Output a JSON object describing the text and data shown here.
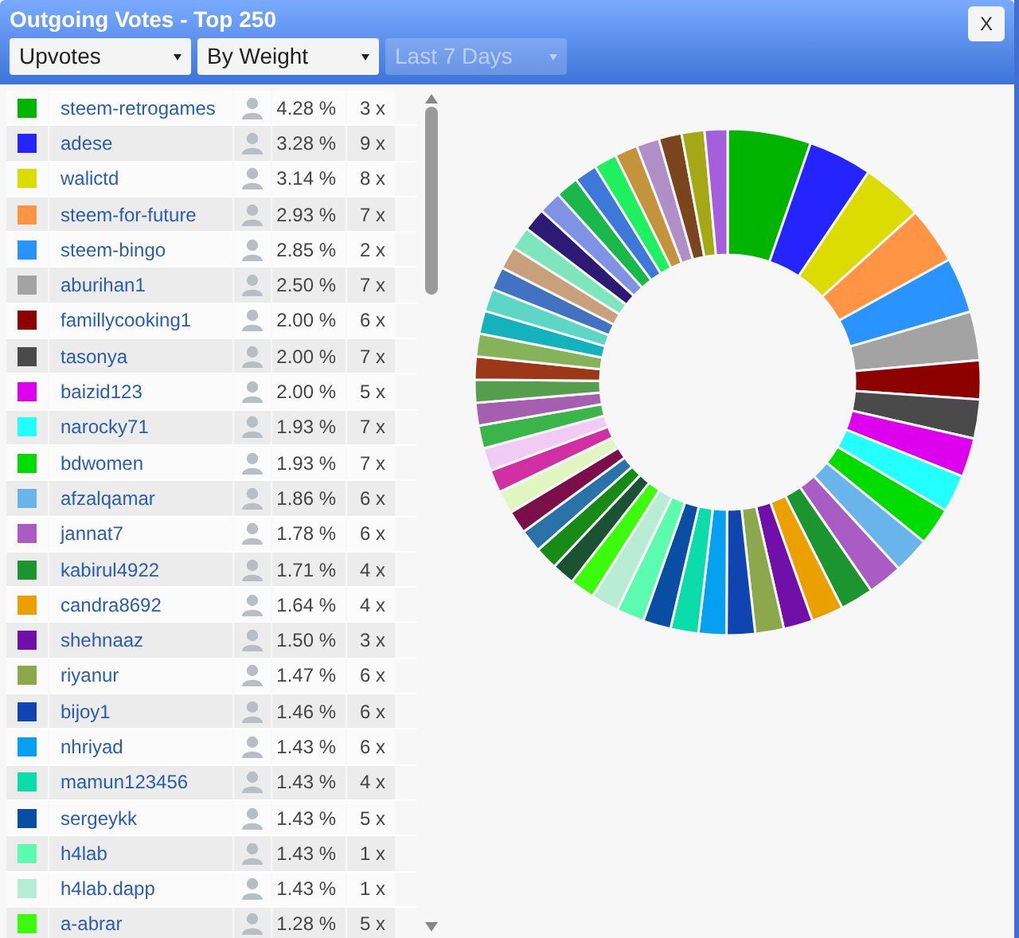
{
  "window": {
    "title": "Outgoing Votes - Top 250",
    "close": "X"
  },
  "filters": [
    {
      "value": "Upvotes",
      "disabled": false
    },
    {
      "value": "By Weight",
      "disabled": false
    },
    {
      "value": "Last 7 Days",
      "disabled": true
    }
  ],
  "rows": [
    {
      "color": "#00b400",
      "name": "steem-retrogames",
      "percent": "4.28 %",
      "count": "3 x"
    },
    {
      "color": "#2424ff",
      "name": "adese",
      "percent": "3.28 %",
      "count": "9 x"
    },
    {
      "color": "#dcdc00",
      "name": "walictd",
      "percent": "3.14 %",
      "count": "8 x"
    },
    {
      "color": "#ff9444",
      "name": "steem-for-future",
      "percent": "2.93 %",
      "count": "7 x"
    },
    {
      "color": "#2994ff",
      "name": "steem-bingo",
      "percent": "2.85 %",
      "count": "2 x"
    },
    {
      "color": "#a3a3a3",
      "name": "aburihan1",
      "percent": "2.50 %",
      "count": "7 x"
    },
    {
      "color": "#8c0000",
      "name": "famillycooking1",
      "percent": "2.00 %",
      "count": "6 x"
    },
    {
      "color": "#4a4a4a",
      "name": "tasonya",
      "percent": "2.00 %",
      "count": "7 x"
    },
    {
      "color": "#dc00ec",
      "name": "baizid123",
      "percent": "2.00 %",
      "count": "5 x"
    },
    {
      "color": "#24ffff",
      "name": "narocky71",
      "percent": "1.93 %",
      "count": "7 x"
    },
    {
      "color": "#00dc00",
      "name": "bdwomen",
      "percent": "1.93 %",
      "count": "7 x"
    },
    {
      "color": "#6ab4ec",
      "name": "afzalqamar",
      "percent": "1.86 %",
      "count": "6 x"
    },
    {
      "color": "#a95cc4",
      "name": "jannat7",
      "percent": "1.78 %",
      "count": "6 x"
    },
    {
      "color": "#1c9430",
      "name": "kabirul4922",
      "percent": "1.71 %",
      "count": "4 x"
    },
    {
      "color": "#eca000",
      "name": "candra8692",
      "percent": "1.64 %",
      "count": "4 x"
    },
    {
      "color": "#7010a8",
      "name": "shehnaaz",
      "percent": "1.50 %",
      "count": "3 x"
    },
    {
      "color": "#8ca84c",
      "name": "riyanur",
      "percent": "1.47 %",
      "count": "6 x"
    },
    {
      "color": "#1044b0",
      "name": "bijoy1",
      "percent": "1.46 %",
      "count": "6 x"
    },
    {
      "color": "#06a0f0",
      "name": "nhriyad",
      "percent": "1.43 %",
      "count": "6 x"
    },
    {
      "color": "#0cdcac",
      "name": "mamun123456",
      "percent": "1.43 %",
      "count": "4 x"
    },
    {
      "color": "#0a4ea4",
      "name": "sergeykk",
      "percent": "1.43 %",
      "count": "5 x"
    },
    {
      "color": "#5cfcb0",
      "name": "h4lab",
      "percent": "1.43 %",
      "count": "1 x"
    },
    {
      "color": "#b8ecd4",
      "name": "h4lab.dapp",
      "percent": "1.43 %",
      "count": "1 x"
    },
    {
      "color": "#3cfc0c",
      "name": "a-abrar",
      "percent": "1.28 %",
      "count": "5 x"
    }
  ]
}
